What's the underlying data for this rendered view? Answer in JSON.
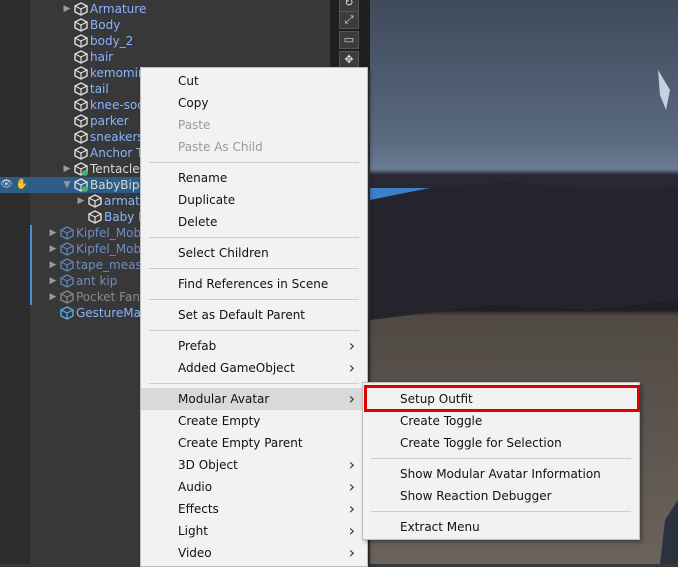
{
  "hierarchy": {
    "items": [
      {
        "label": "Armature",
        "indent": 1,
        "arrow": true,
        "style": "normal"
      },
      {
        "label": "Body",
        "indent": 1,
        "arrow": false,
        "style": "normal"
      },
      {
        "label": "body_2",
        "indent": 1,
        "arrow": false,
        "style": "normal"
      },
      {
        "label": "hair",
        "indent": 1,
        "arrow": false,
        "style": "normal"
      },
      {
        "label": "kemomin",
        "indent": 1,
        "arrow": false,
        "style": "normal"
      },
      {
        "label": "tail",
        "indent": 1,
        "arrow": false,
        "style": "normal"
      },
      {
        "label": "knee-soc",
        "indent": 1,
        "arrow": false,
        "style": "normal"
      },
      {
        "label": "parker",
        "indent": 1,
        "arrow": false,
        "style": "normal"
      },
      {
        "label": "sneakers",
        "indent": 1,
        "arrow": false,
        "style": "normal"
      },
      {
        "label": "Anchor T",
        "indent": 1,
        "arrow": false,
        "style": "normal"
      },
      {
        "label": "Tentacle",
        "indent": 1,
        "arrow": true,
        "style": "white"
      },
      {
        "label": "BabyBip",
        "indent": 1,
        "arrow": true,
        "style": "white",
        "selected": true
      },
      {
        "label": "armatu",
        "indent": 2,
        "arrow": true,
        "style": "normal"
      },
      {
        "label": "Baby B",
        "indent": 2,
        "arrow": false,
        "style": "normal"
      },
      {
        "label": "Kipfel_Mob",
        "indent": 0,
        "arrow": true,
        "style": "dim"
      },
      {
        "label": "Kipfel_Mob",
        "indent": 0,
        "arrow": true,
        "style": "dim"
      },
      {
        "label": "tape_meas",
        "indent": 0,
        "arrow": true,
        "style": "dim"
      },
      {
        "label": "ant kip",
        "indent": 0,
        "arrow": true,
        "style": "dim"
      },
      {
        "label": "Pocket Fan",
        "indent": 0,
        "arrow": true,
        "style": "gray"
      },
      {
        "label": "GestureMa",
        "indent": 0,
        "arrow": false,
        "style": "normal"
      }
    ]
  },
  "context_menu": {
    "items": [
      {
        "label": "Cut",
        "type": "item"
      },
      {
        "label": "Copy",
        "type": "item"
      },
      {
        "label": "Paste",
        "type": "item",
        "disabled": true
      },
      {
        "label": "Paste As Child",
        "type": "item",
        "disabled": true
      },
      {
        "type": "sep"
      },
      {
        "label": "Rename",
        "type": "item"
      },
      {
        "label": "Duplicate",
        "type": "item"
      },
      {
        "label": "Delete",
        "type": "item"
      },
      {
        "type": "sep"
      },
      {
        "label": "Select Children",
        "type": "item"
      },
      {
        "type": "sep"
      },
      {
        "label": "Find References in Scene",
        "type": "item"
      },
      {
        "type": "sep"
      },
      {
        "label": "Set as Default Parent",
        "type": "item"
      },
      {
        "type": "sep"
      },
      {
        "label": "Prefab",
        "type": "item",
        "submenu": true
      },
      {
        "label": "Added GameObject",
        "type": "item",
        "submenu": true
      },
      {
        "type": "sep"
      },
      {
        "label": "Modular Avatar",
        "type": "item",
        "submenu": true,
        "hover": true
      },
      {
        "label": "Create Empty",
        "type": "item"
      },
      {
        "label": "Create Empty Parent",
        "type": "item"
      },
      {
        "label": "3D Object",
        "type": "item",
        "submenu": true
      },
      {
        "label": "Audio",
        "type": "item",
        "submenu": true
      },
      {
        "label": "Effects",
        "type": "item",
        "submenu": true
      },
      {
        "label": "Light",
        "type": "item",
        "submenu": true
      },
      {
        "label": "Video",
        "type": "item",
        "submenu": true
      }
    ]
  },
  "submenu": {
    "items": [
      {
        "label": "Setup Outfit",
        "type": "item",
        "highlighted": true
      },
      {
        "label": "Create Toggle",
        "type": "item"
      },
      {
        "label": "Create Toggle for Selection",
        "type": "item"
      },
      {
        "type": "sep"
      },
      {
        "label": "Show Modular Avatar Information",
        "type": "item"
      },
      {
        "label": "Show Reaction Debugger",
        "type": "item"
      },
      {
        "type": "sep"
      },
      {
        "label": "Extract Menu",
        "type": "item"
      }
    ]
  },
  "icons": {
    "submenu_arrow": "chevron-right-icon",
    "expand_arrow": "triangle-right-icon",
    "gameobject": "cube-icon",
    "visibility": "eye-icon"
  },
  "colors": {
    "highlight_border": "#e00000",
    "selection": "#2c5d87",
    "menu_bg": "#f2f2f2"
  }
}
